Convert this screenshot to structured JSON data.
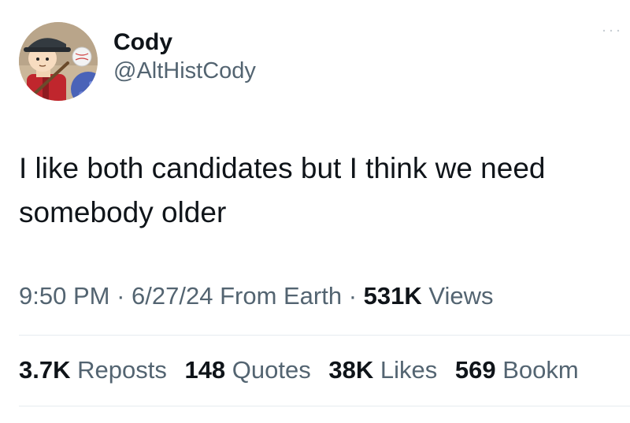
{
  "author": {
    "display_name": "Cody",
    "handle": "@AltHistCody"
  },
  "tweet": {
    "text": "I like both candidates but I think we need somebody older"
  },
  "meta": {
    "time": "9:50 PM",
    "sep1": " · ",
    "date": "6/27/24",
    "source": " From Earth",
    "sep2": " · ",
    "views_count": "531K",
    "views_label": " Views"
  },
  "stats": [
    {
      "count": "3.7K",
      "label": " Reposts"
    },
    {
      "count": "148",
      "label": " Quotes"
    },
    {
      "count": "38K",
      "label": " Likes"
    },
    {
      "count": "569",
      "label": " Bookm"
    }
  ],
  "icons": {
    "more": "more-dots-icon",
    "avatar": "cartoon-avatar-with-baseball-cap"
  }
}
